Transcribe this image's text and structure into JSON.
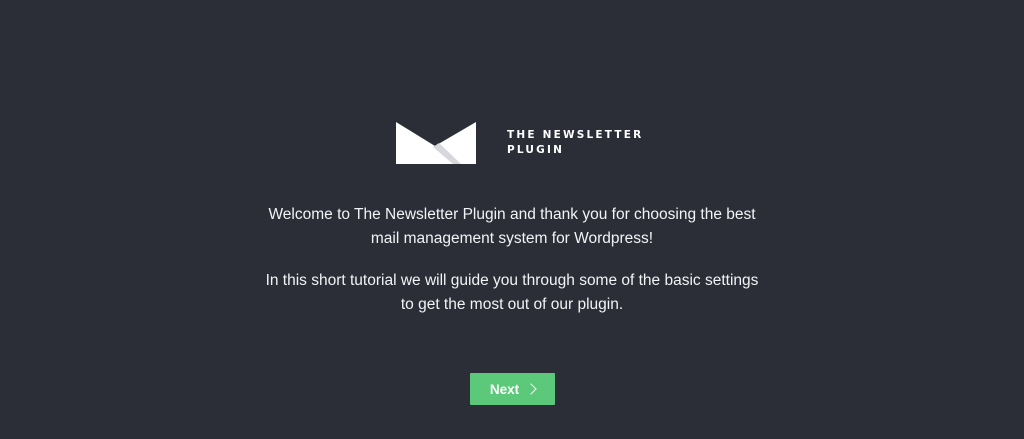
{
  "logo": {
    "icon": "envelope-icon",
    "line1": "THE NEWSLETTER",
    "line2": "PLUGIN"
  },
  "intro": {
    "paragraph1": "Welcome to The Newsletter Plugin and thank you for choosing the best mail management system for Wordpress!",
    "paragraph2": "In this short tutorial we will guide you through some of the basic settings to get the most out of our plugin."
  },
  "actions": {
    "next_label": "Next",
    "next_icon": "chevron-right-icon"
  },
  "colors": {
    "background": "#2b2e37",
    "accent": "#5cc97a",
    "text": "#ffffff"
  }
}
